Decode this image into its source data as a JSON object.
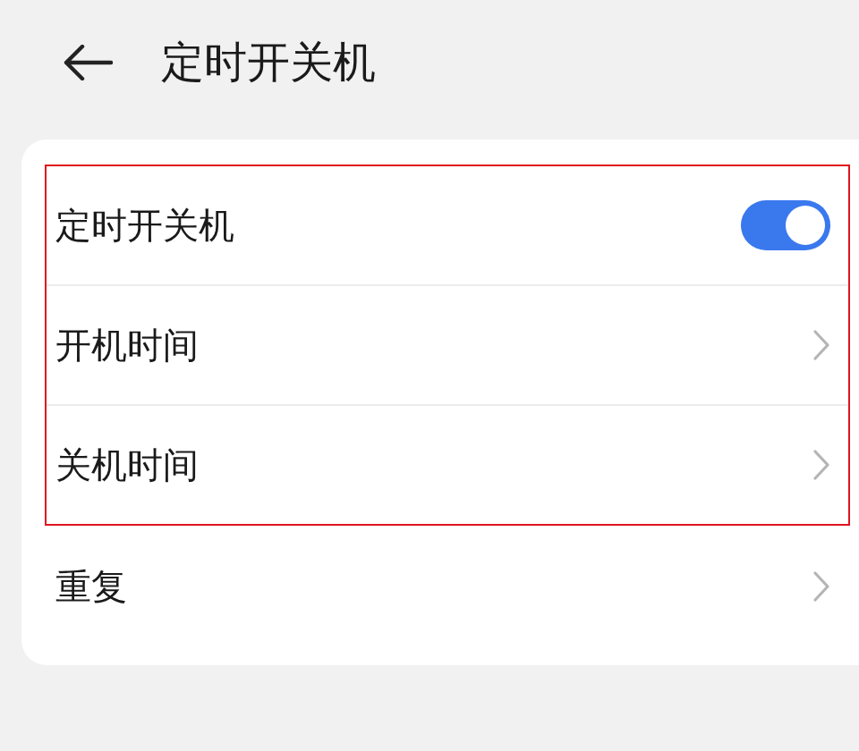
{
  "header": {
    "title": "定时开关机"
  },
  "rows": [
    {
      "kind": "toggle",
      "label": "定时开关机",
      "on": true,
      "highlighted": true
    },
    {
      "kind": "link",
      "label": "开机时间",
      "highlighted": true
    },
    {
      "kind": "link",
      "label": "关机时间",
      "highlighted": true
    },
    {
      "kind": "link",
      "label": "重复",
      "highlighted": false
    }
  ]
}
